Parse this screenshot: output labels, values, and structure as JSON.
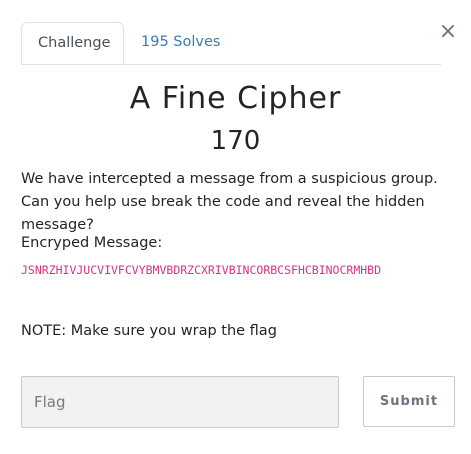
{
  "modal": {
    "close_symbol": "×"
  },
  "tabs": [
    {
      "label": "Challenge",
      "active": true
    },
    {
      "label": "195 Solves",
      "active": false
    }
  ],
  "challenge": {
    "title": "A Fine Cipher",
    "points": "170",
    "description": "We have intercepted a message from a suspicious group. Can you help use break the code and reveal the hidden message?",
    "encrypted_label": "Encryped Message:",
    "encrypted_message": "JSNRZHIVJUCVIVFCVYBMVBDRZCXRIVBINCORBCSFHCBINOCRMHBD",
    "note": "NOTE: Make sure you wrap the flag"
  },
  "form": {
    "flag_placeholder": "Flag",
    "flag_value": "",
    "submit_label": "Submit"
  },
  "colors": {
    "link": "#3a7ab5",
    "code": "#d63384",
    "text": "#212529"
  },
  "icons": {
    "close": "close-icon"
  }
}
